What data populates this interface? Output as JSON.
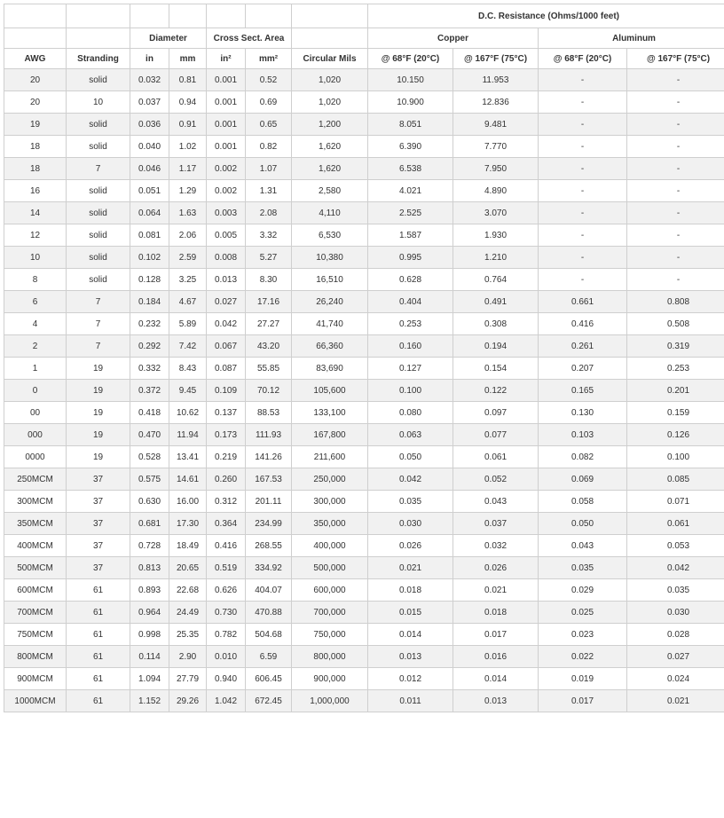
{
  "headers": {
    "awg": "AWG",
    "stranding": "Stranding",
    "diameter": "Diameter",
    "cross_sect_area": "Cross Sect. Area",
    "circular_mils": "Circular Mils",
    "dc_resistance": "D.C. Resistance (Ohms/1000 feet)",
    "copper": "Copper",
    "aluminum": "Aluminum",
    "in": "in",
    "mm": "mm",
    "in2": "in²",
    "mm2": "mm²",
    "cu_68": "@ 68°F (20°C)",
    "cu_167": "@ 167°F (75°C)",
    "al_68": "@ 68°F (20°C)",
    "al_167": "@ 167°F (75°C)"
  },
  "rows": [
    [
      "20",
      "solid",
      "0.032",
      "0.81",
      "0.001",
      "0.52",
      "1,020",
      "10.150",
      "11.953",
      "-",
      "-"
    ],
    [
      "20",
      "10",
      "0.037",
      "0.94",
      "0.001",
      "0.69",
      "1,020",
      "10.900",
      "12.836",
      "-",
      "-"
    ],
    [
      "19",
      "solid",
      "0.036",
      "0.91",
      "0.001",
      "0.65",
      "1,200",
      "8.051",
      "9.481",
      "-",
      "-"
    ],
    [
      "18",
      "solid",
      "0.040",
      "1.02",
      "0.001",
      "0.82",
      "1,620",
      "6.390",
      "7.770",
      "-",
      "-"
    ],
    [
      "18",
      "7",
      "0.046",
      "1.17",
      "0.002",
      "1.07",
      "1,620",
      "6.538",
      "7.950",
      "-",
      "-"
    ],
    [
      "16",
      "solid",
      "0.051",
      "1.29",
      "0.002",
      "1.31",
      "2,580",
      "4.021",
      "4.890",
      "-",
      "-"
    ],
    [
      "14",
      "solid",
      "0.064",
      "1.63",
      "0.003",
      "2.08",
      "4,110",
      "2.525",
      "3.070",
      "-",
      "-"
    ],
    [
      "12",
      "solid",
      "0.081",
      "2.06",
      "0.005",
      "3.32",
      "6,530",
      "1.587",
      "1.930",
      "-",
      "-"
    ],
    [
      "10",
      "solid",
      "0.102",
      "2.59",
      "0.008",
      "5.27",
      "10,380",
      "0.995",
      "1.210",
      "-",
      "-"
    ],
    [
      "8",
      "solid",
      "0.128",
      "3.25",
      "0.013",
      "8.30",
      "16,510",
      "0.628",
      "0.764",
      "-",
      "-"
    ],
    [
      "6",
      "7",
      "0.184",
      "4.67",
      "0.027",
      "17.16",
      "26,240",
      "0.404",
      "0.491",
      "0.661",
      "0.808"
    ],
    [
      "4",
      "7",
      "0.232",
      "5.89",
      "0.042",
      "27.27",
      "41,740",
      "0.253",
      "0.308",
      "0.416",
      "0.508"
    ],
    [
      "2",
      "7",
      "0.292",
      "7.42",
      "0.067",
      "43.20",
      "66,360",
      "0.160",
      "0.194",
      "0.261",
      "0.319"
    ],
    [
      "1",
      "19",
      "0.332",
      "8.43",
      "0.087",
      "55.85",
      "83,690",
      "0.127",
      "0.154",
      "0.207",
      "0.253"
    ],
    [
      "0",
      "19",
      "0.372",
      "9.45",
      "0.109",
      "70.12",
      "105,600",
      "0.100",
      "0.122",
      "0.165",
      "0.201"
    ],
    [
      "00",
      "19",
      "0.418",
      "10.62",
      "0.137",
      "88.53",
      "133,100",
      "0.080",
      "0.097",
      "0.130",
      "0.159"
    ],
    [
      "000",
      "19",
      "0.470",
      "11.94",
      "0.173",
      "111.93",
      "167,800",
      "0.063",
      "0.077",
      "0.103",
      "0.126"
    ],
    [
      "0000",
      "19",
      "0.528",
      "13.41",
      "0.219",
      "141.26",
      "211,600",
      "0.050",
      "0.061",
      "0.082",
      "0.100"
    ],
    [
      "250MCM",
      "37",
      "0.575",
      "14.61",
      "0.260",
      "167.53",
      "250,000",
      "0.042",
      "0.052",
      "0.069",
      "0.085"
    ],
    [
      "300MCM",
      "37",
      "0.630",
      "16.00",
      "0.312",
      "201.11",
      "300,000",
      "0.035",
      "0.043",
      "0.058",
      "0.071"
    ],
    [
      "350MCM",
      "37",
      "0.681",
      "17.30",
      "0.364",
      "234.99",
      "350,000",
      "0.030",
      "0.037",
      "0.050",
      "0.061"
    ],
    [
      "400MCM",
      "37",
      "0.728",
      "18.49",
      "0.416",
      "268.55",
      "400,000",
      "0.026",
      "0.032",
      "0.043",
      "0.053"
    ],
    [
      "500MCM",
      "37",
      "0.813",
      "20.65",
      "0.519",
      "334.92",
      "500,000",
      "0.021",
      "0.026",
      "0.035",
      "0.042"
    ],
    [
      "600MCM",
      "61",
      "0.893",
      "22.68",
      "0.626",
      "404.07",
      "600,000",
      "0.018",
      "0.021",
      "0.029",
      "0.035"
    ],
    [
      "700MCM",
      "61",
      "0.964",
      "24.49",
      "0.730",
      "470.88",
      "700,000",
      "0.015",
      "0.018",
      "0.025",
      "0.030"
    ],
    [
      "750MCM",
      "61",
      "0.998",
      "25.35",
      "0.782",
      "504.68",
      "750,000",
      "0.014",
      "0.017",
      "0.023",
      "0.028"
    ],
    [
      "800MCM",
      "61",
      "0.114",
      "2.90",
      "0.010",
      "6.59",
      "800,000",
      "0.013",
      "0.016",
      "0.022",
      "0.027"
    ],
    [
      "900MCM",
      "61",
      "1.094",
      "27.79",
      "0.940",
      "606.45",
      "900,000",
      "0.012",
      "0.014",
      "0.019",
      "0.024"
    ],
    [
      "1000MCM",
      "61",
      "1.152",
      "29.26",
      "1.042",
      "672.45",
      "1,000,000",
      "0.011",
      "0.013",
      "0.017",
      "0.021"
    ]
  ]
}
